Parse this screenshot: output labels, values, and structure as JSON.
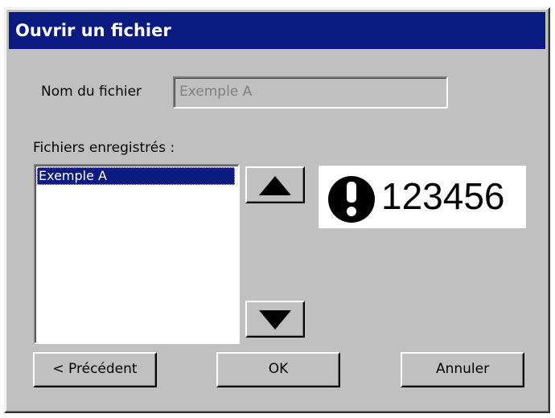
{
  "dialog": {
    "title": "Ouvrir un fichier",
    "filename_label": "Nom du fichier",
    "filename_value": "Exemple A",
    "saved_files_label": "Fichiers enregistrés :",
    "saved_files": [
      {
        "name": "Exemple A",
        "selected": true
      }
    ],
    "preview": {
      "icon": "exclamation-circle-icon",
      "text": "123456"
    },
    "buttons": {
      "scroll_up": "up-arrow-icon",
      "scroll_down": "down-arrow-icon",
      "previous": "< Précédent",
      "ok": "OK",
      "cancel": "Annuler"
    }
  },
  "colors": {
    "titlebar": "#0b1a80",
    "selection": "#0b1a80",
    "dialog_bg": "#c0c0c0"
  }
}
